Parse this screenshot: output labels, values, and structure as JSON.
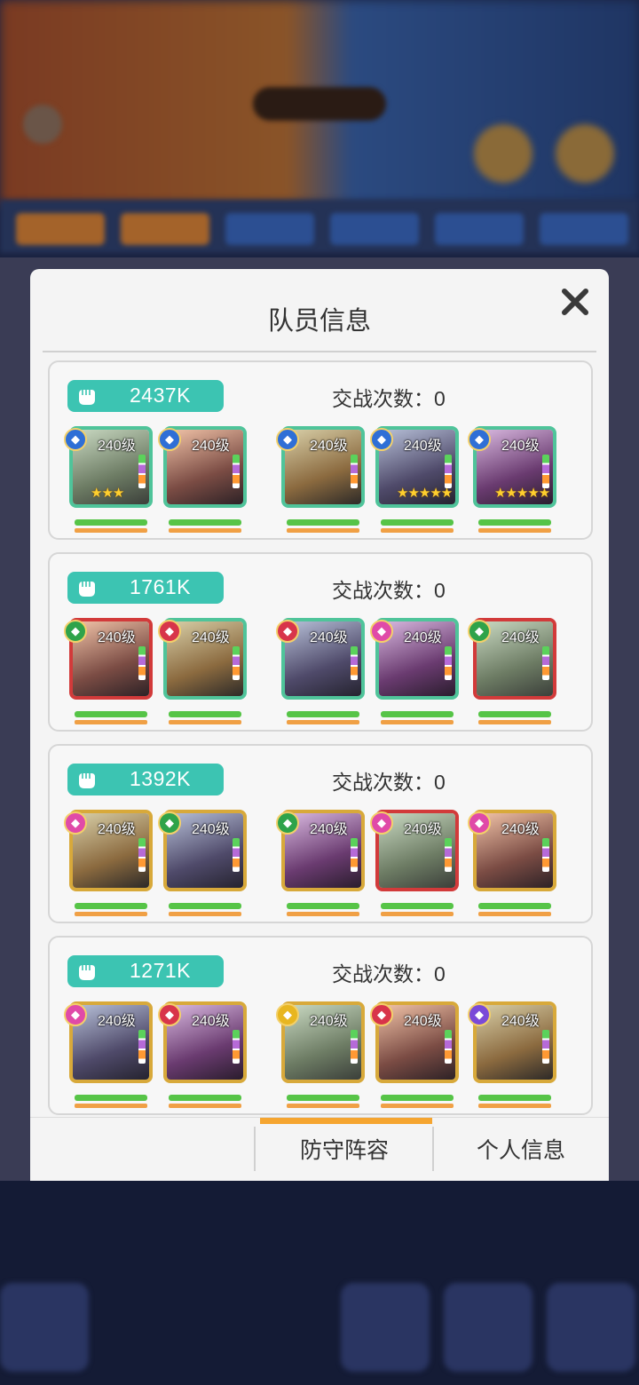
{
  "dialog": {
    "title": "队员信息"
  },
  "teams": [
    {
      "power": "2437K",
      "battles_label": "交战次数：",
      "battles": "0",
      "heroes": [
        {
          "level": "240级",
          "faction": "blue",
          "stars": "★★★",
          "frame": "green"
        },
        {
          "level": "240级",
          "faction": "blue",
          "stars": "",
          "frame": "green"
        },
        {
          "level": "240级",
          "faction": "blue",
          "stars": "",
          "frame": "green"
        },
        {
          "level": "240级",
          "faction": "blue",
          "stars": "★★★★★",
          "frame": "green"
        },
        {
          "level": "240级",
          "faction": "blue",
          "stars": "★★★★★",
          "frame": "green"
        }
      ]
    },
    {
      "power": "1761K",
      "battles_label": "交战次数：",
      "battles": "0",
      "heroes": [
        {
          "level": "240级",
          "faction": "green",
          "stars": "",
          "frame": "red"
        },
        {
          "level": "240级",
          "faction": "red",
          "stars": "",
          "frame": "green"
        },
        {
          "level": "240级",
          "faction": "red",
          "stars": "",
          "frame": "green"
        },
        {
          "level": "240级",
          "faction": "pink",
          "stars": "",
          "frame": "green"
        },
        {
          "level": "240级",
          "faction": "green",
          "stars": "",
          "frame": "red"
        }
      ]
    },
    {
      "power": "1392K",
      "battles_label": "交战次数：",
      "battles": "0",
      "heroes": [
        {
          "level": "240级",
          "faction": "pink",
          "stars": "",
          "frame": "gold"
        },
        {
          "level": "240级",
          "faction": "green",
          "stars": "",
          "frame": "gold"
        },
        {
          "level": "240级",
          "faction": "green",
          "stars": "",
          "frame": "gold"
        },
        {
          "level": "240级",
          "faction": "pink",
          "stars": "",
          "frame": "red"
        },
        {
          "level": "240级",
          "faction": "pink",
          "stars": "",
          "frame": "gold"
        }
      ]
    },
    {
      "power": "1271K",
      "battles_label": "交战次数：",
      "battles": "0",
      "heroes": [
        {
          "level": "240级",
          "faction": "pink",
          "stars": "",
          "frame": "gold"
        },
        {
          "level": "240级",
          "faction": "red",
          "stars": "",
          "frame": "gold"
        },
        {
          "level": "240级",
          "faction": "gold",
          "stars": "",
          "frame": "gold"
        },
        {
          "level": "240级",
          "faction": "red",
          "stars": "",
          "frame": "gold"
        },
        {
          "level": "240级",
          "faction": "purple",
          "stars": "",
          "frame": "gold"
        }
      ]
    }
  ],
  "tabs": [
    {
      "label": "防守阵容"
    },
    {
      "label": "个人信息"
    }
  ],
  "colors": {
    "power_badge": "#3cc4b2",
    "hp_bar": "#56c447",
    "energy_bar": "#f0a045",
    "active_tab": "#f5a530"
  }
}
